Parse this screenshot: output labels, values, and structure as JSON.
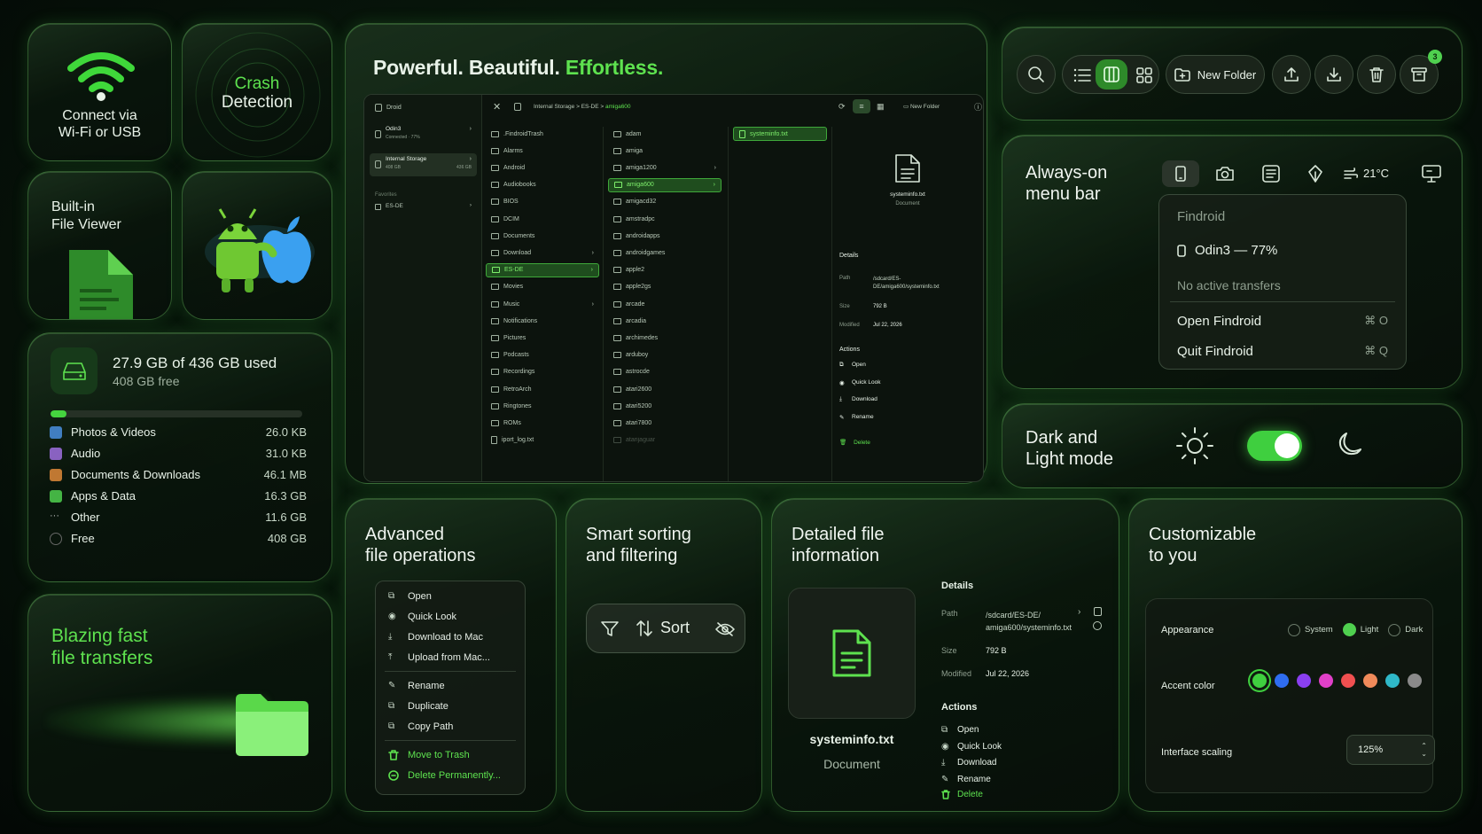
{
  "tiles": {
    "wifi": {
      "line1": "Connect via",
      "line2": "Wi-Fi or USB"
    },
    "crash": {
      "line1": "Crash",
      "line2": "Detection"
    },
    "viewer": {
      "line1": "Built-in",
      "line2": "File Viewer"
    }
  },
  "storage": {
    "used": "27.9 GB of 436 GB used",
    "free": "408 GB free",
    "used_fraction": 0.064,
    "items": [
      {
        "label": "Photos & Videos",
        "value": "26.0 KB",
        "color": "#4a8fe0"
      },
      {
        "label": "Audio",
        "value": "31.0 KB",
        "color": "#a070e0"
      },
      {
        "label": "Documents & Downloads",
        "value": "46.1 MB",
        "color": "#e08a3a"
      },
      {
        "label": "Apps & Data",
        "value": "16.3 GB",
        "color": "#4fd04f"
      },
      {
        "label": "Other",
        "value": "11.6 GB",
        "color": "#cccccc"
      },
      {
        "label": "Free",
        "value": "408 GB",
        "color": "#777777"
      }
    ]
  },
  "transfers": {
    "line1": "Blazing fast",
    "line2": "file transfers"
  },
  "hero": {
    "title_white": "Powerful. Beautiful.",
    "title_green": "Effortless."
  },
  "browser": {
    "sidebar": {
      "header": "Droid",
      "devices": [
        {
          "name": "Odin3",
          "sub": "Connected · 77%"
        },
        {
          "name": "Internal Storage",
          "sub": "408 GB",
          "right": "436 GB"
        }
      ],
      "favorites_label": "Favorites",
      "favorites": [
        "ES-DE"
      ]
    },
    "breadcrumb": {
      "a": "Internal Storage",
      "b": "ES-DE",
      "c": "amiga600"
    },
    "new_folder": "New Folder",
    "col1": [
      ".FindroidTrash",
      "Alarms",
      "Android",
      "Audiobooks",
      "BIOS",
      "DCIM",
      "Documents",
      "Download",
      "ES-DE",
      "Movies",
      "Music",
      "Notifications",
      "Pictures",
      "Podcasts",
      "Recordings",
      "RetroArch",
      "Ringtones",
      "ROMs",
      "iport_log.txt"
    ],
    "col2": [
      "adam",
      "amiga",
      "amiga1200",
      "amiga600",
      "amigacd32",
      "amstradpc",
      "androidapps",
      "androidgames",
      "apple2",
      "apple2gs",
      "arcade",
      "arcadia",
      "archimedes",
      "arduboy",
      "astrocde",
      "atari2600",
      "atari5200",
      "atari7800",
      "atarijaguar"
    ],
    "col3": [
      "systeminfo.txt"
    ],
    "preview": {
      "name": "systeminfo.txt",
      "kind": "Document"
    },
    "details_label": "Details",
    "path_label": "Path",
    "path": "/sdcard/ES-DE/amiga600/systeminfo.txt",
    "size_label": "Size",
    "size": "792 B",
    "modified_label": "Modified",
    "modified": "Jul 22, 2026",
    "actions_label": "Actions",
    "actions": [
      "Open",
      "Quick Look",
      "Download",
      "Rename"
    ],
    "delete": "Delete"
  },
  "toolbar": {
    "new_folder": "New Folder",
    "badge": "3"
  },
  "menubar": {
    "title1": "Always-on",
    "title2": "menu bar",
    "temp": "21°C",
    "app": "Findroid",
    "device": "Odin3 — 77%",
    "status": "No active transfers",
    "open": "Open Findroid",
    "open_key": "⌘ O",
    "quit": "Quit Findroid",
    "quit_key": "⌘ Q"
  },
  "theme": {
    "line1": "Dark and",
    "line2": "Light mode",
    "toggle_on": true
  },
  "ops": {
    "line1": "Advanced",
    "line2": "file operations",
    "items": [
      "Open",
      "Quick Look",
      "Download to Mac",
      "Upload from Mac...",
      "Rename",
      "Duplicate",
      "Copy Path"
    ],
    "trash": "Move to Trash",
    "delete": "Delete Permanently..."
  },
  "sorting": {
    "line1": "Smart sorting",
    "line2": "and filtering",
    "sort": "Sort"
  },
  "info": {
    "line1": "Detailed file",
    "line2": "information",
    "name": "systeminfo.txt",
    "kind": "Document",
    "details": "Details",
    "path_label": "Path",
    "path1": "/sdcard/ES-DE/",
    "path2": "amiga600/systeminfo.txt",
    "size_label": "Size",
    "size": "792 B",
    "modified_label": "Modified",
    "modified": "Jul 22, 2026",
    "actions": "Actions",
    "items": [
      "Open",
      "Quick Look",
      "Download",
      "Rename"
    ],
    "delete": "Delete"
  },
  "custom": {
    "line1": "Customizable",
    "line2": "to you",
    "appearance": "Appearance",
    "opt_system": "System",
    "opt_light": "Light",
    "opt_dark": "Dark",
    "accent": "Accent color",
    "accent_colors": [
      "#3fcf3f",
      "#2f6df0",
      "#8a3ff0",
      "#e040c8",
      "#f05050",
      "#f08a5a",
      "#2fb8c8",
      "#8a8a8a"
    ],
    "scaling": "Interface scaling",
    "scaling_value": "125%"
  }
}
